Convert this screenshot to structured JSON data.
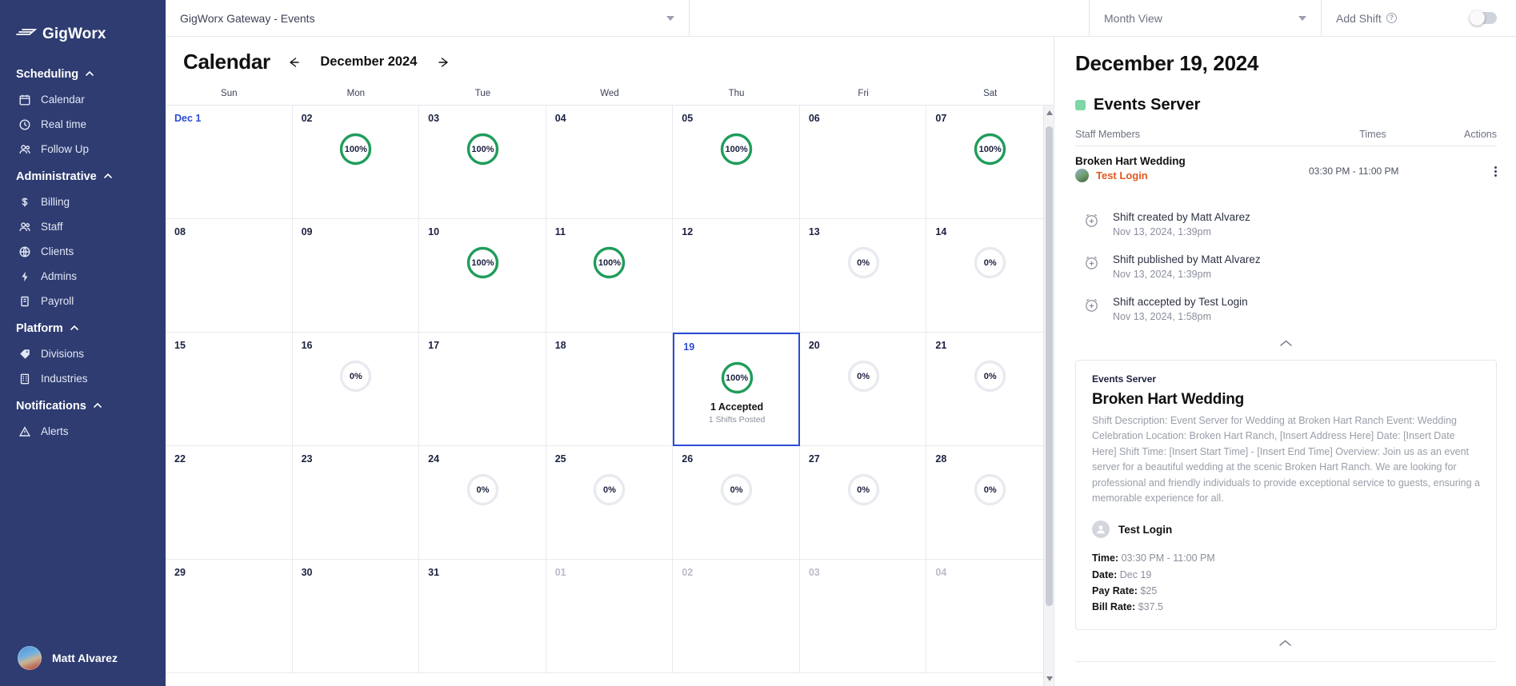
{
  "brand": {
    "name": "GigWorx",
    "logo_icon": "gigworx-logo-icon"
  },
  "sidebar": {
    "groups": [
      {
        "label": "Scheduling",
        "chevron_icon": "chevron-up-icon",
        "items": [
          {
            "label": "Calendar",
            "icon": "calendar-icon"
          },
          {
            "label": "Real time",
            "icon": "clock-icon"
          },
          {
            "label": "Follow Up",
            "icon": "people-icon"
          }
        ]
      },
      {
        "label": "Administrative",
        "chevron_icon": "chevron-up-icon",
        "items": [
          {
            "label": "Billing",
            "icon": "dollar-icon"
          },
          {
            "label": "Staff",
            "icon": "people-icon"
          },
          {
            "label": "Clients",
            "icon": "globe-icon"
          },
          {
            "label": "Admins",
            "icon": "bolt-icon"
          },
          {
            "label": "Payroll",
            "icon": "book-icon"
          }
        ]
      },
      {
        "label": "Platform",
        "chevron_icon": "chevron-up-icon",
        "items": [
          {
            "label": "Divisions",
            "icon": "tag-icon"
          },
          {
            "label": "Industries",
            "icon": "building-icon"
          }
        ]
      },
      {
        "label": "Notifications",
        "chevron_icon": "chevron-up-icon",
        "items": [
          {
            "label": "Alerts",
            "icon": "warning-triangle-icon"
          }
        ]
      }
    ],
    "profile": {
      "name": "Matt Alvarez",
      "avatar_icon": "user-avatar"
    }
  },
  "topbar": {
    "account_select": {
      "value": "GigWorx Gateway - Events",
      "caret_icon": "caret-down-icon"
    },
    "view_select": {
      "value": "Month View",
      "caret_icon": "caret-down-icon"
    },
    "add_shift": {
      "label": "Add Shift",
      "help_icon": "question-circle-icon",
      "toggle_state": "off"
    }
  },
  "calendar": {
    "title": "Calendar",
    "month_label": "December 2024",
    "prev_icon": "arrow-left-icon",
    "next_icon": "arrow-right-icon",
    "weekdays": [
      "Sun",
      "Mon",
      "Tue",
      "Wed",
      "Thu",
      "Fri",
      "Sat"
    ],
    "days": [
      {
        "label": "Dec 1",
        "first_sun": true
      },
      {
        "label": "02",
        "pct": 100
      },
      {
        "label": "03",
        "pct": 100
      },
      {
        "label": "04"
      },
      {
        "label": "05",
        "pct": 100
      },
      {
        "label": "06"
      },
      {
        "label": "07",
        "pct": 100
      },
      {
        "label": "08"
      },
      {
        "label": "09"
      },
      {
        "label": "10",
        "pct": 100
      },
      {
        "label": "11",
        "pct": 100
      },
      {
        "label": "12"
      },
      {
        "label": "13",
        "pct": 0
      },
      {
        "label": "14",
        "pct": 0
      },
      {
        "label": "15"
      },
      {
        "label": "16",
        "pct": 0
      },
      {
        "label": "17"
      },
      {
        "label": "18"
      },
      {
        "label": "19",
        "pct": 100,
        "today": true,
        "sub1": "1 Accepted",
        "sub2": "1 Shifts Posted"
      },
      {
        "label": "20",
        "pct": 0
      },
      {
        "label": "21",
        "pct": 0
      },
      {
        "label": "22"
      },
      {
        "label": "23"
      },
      {
        "label": "24",
        "pct": 0
      },
      {
        "label": "25",
        "pct": 0
      },
      {
        "label": "26",
        "pct": 0
      },
      {
        "label": "27",
        "pct": 0
      },
      {
        "label": "28",
        "pct": 0
      },
      {
        "label": "29"
      },
      {
        "label": "30"
      },
      {
        "label": "31"
      },
      {
        "label": "01",
        "other": true
      },
      {
        "label": "02",
        "other": true
      },
      {
        "label": "03",
        "other": true
      },
      {
        "label": "04",
        "other": true
      }
    ],
    "colors": {
      "complete": "#1f9d5a",
      "empty": "#e9eaf0",
      "today_border": "#2b4cd6"
    }
  },
  "detail": {
    "date": "December 19, 2024",
    "role": {
      "name": "Events Server",
      "dot_color": "#7fd6a6"
    },
    "table_headers": {
      "staff": "Staff Members",
      "times": "Times",
      "actions": "Actions"
    },
    "shift_row": {
      "title": "Broken Hart Wedding",
      "person": "Test Login",
      "times": "03:30 PM - 11:00 PM",
      "menu_icon": "kebab-menu-icon"
    },
    "log": [
      {
        "title": "Shift created by Matt Alvarez",
        "time": "Nov 13, 2024, 1:39pm",
        "icon": "alarm-add-icon"
      },
      {
        "title": "Shift published by Matt Alvarez",
        "time": "Nov 13, 2024, 1:39pm",
        "icon": "alarm-add-icon"
      },
      {
        "title": "Shift accepted by Test Login",
        "time": "Nov 13, 2024, 1:58pm",
        "icon": "alarm-add-icon"
      }
    ],
    "collapse_icon": "chevron-up-icon",
    "card": {
      "eyebrow": "Events Server",
      "title": "Broken Hart Wedding",
      "description": "Shift Description: Event Server for Wedding at Broken Hart Ranch Event: Wedding Celebration Location: Broken Hart Ranch, [Insert Address Here] Date: [Insert Date Here] Shift Time: [Insert Start Time] - [Insert End Time] Overview: Join us as an event server for a beautiful wedding at the scenic Broken Hart Ranch. We are looking for professional and friendly individuals to provide exceptional service to guests, ensuring a memorable experience for all.",
      "person": "Test Login",
      "person_icon": "user-avatar-icon",
      "meta": [
        {
          "label": "Time:",
          "value": "03:30 PM - 11:00 PM"
        },
        {
          "label": "Date:",
          "value": "Dec 19"
        },
        {
          "label": "Pay Rate:",
          "value": "$25"
        },
        {
          "label": "Bill Rate:",
          "value": "$37.5"
        }
      ]
    }
  }
}
